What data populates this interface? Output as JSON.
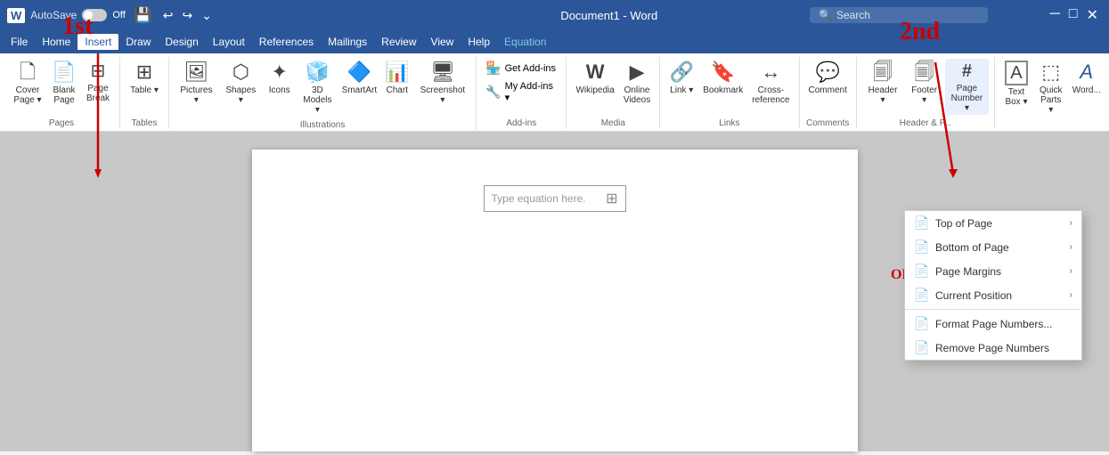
{
  "titlebar": {
    "word_icon": "W",
    "autosave": "AutoSave",
    "toggle_state": "Off",
    "document_title": "Document1 - Word",
    "search_placeholder": "Search"
  },
  "menubar": {
    "items": [
      "File",
      "Home",
      "Insert",
      "Draw",
      "Design",
      "Layout",
      "References",
      "Mailings",
      "Review",
      "View",
      "Help",
      "Equation"
    ],
    "active": "Insert"
  },
  "ribbon": {
    "pages_group": {
      "label": "Pages",
      "buttons": [
        {
          "id": "cover-page",
          "label": "Cover\nPage",
          "icon": "🗋"
        },
        {
          "id": "blank-page",
          "label": "Blank\nPage",
          "icon": "📄"
        },
        {
          "id": "page-break",
          "label": "Page\nBreak",
          "icon": "⊟"
        }
      ]
    },
    "tables_group": {
      "label": "Tables",
      "buttons": [
        {
          "id": "table",
          "label": "Table",
          "icon": "⊞"
        }
      ]
    },
    "illustrations_group": {
      "label": "Illustrations",
      "buttons": [
        {
          "id": "pictures",
          "label": "Pictures",
          "icon": "🖼"
        },
        {
          "id": "shapes",
          "label": "Shapes",
          "icon": "⬡"
        },
        {
          "id": "icons",
          "label": "Icons",
          "icon": "✦"
        },
        {
          "id": "3d-models",
          "label": "3D\nModels",
          "icon": "🧊"
        },
        {
          "id": "smartart",
          "label": "SmartArt",
          "icon": "🔷"
        },
        {
          "id": "chart",
          "label": "Chart",
          "icon": "📊"
        },
        {
          "id": "screenshot",
          "label": "Screenshot",
          "icon": "🖥"
        }
      ]
    },
    "addins_group": {
      "label": "Add-ins",
      "buttons": [
        {
          "id": "get-addins",
          "label": "Get Add-ins",
          "icon": "🏪"
        },
        {
          "id": "my-addins",
          "label": "My Add-ins",
          "icon": "🔧"
        }
      ]
    },
    "media_group": {
      "label": "Media",
      "buttons": [
        {
          "id": "wikipedia",
          "label": "Wikipedia",
          "icon": "W"
        },
        {
          "id": "online-videos",
          "label": "Online\nVideos",
          "icon": "▶"
        }
      ]
    },
    "links_group": {
      "label": "Links",
      "buttons": [
        {
          "id": "link",
          "label": "Link",
          "icon": "🔗"
        },
        {
          "id": "bookmark",
          "label": "Bookmark",
          "icon": "🔖"
        },
        {
          "id": "cross-reference",
          "label": "Cross-\nreference",
          "icon": "↔"
        }
      ]
    },
    "comments_group": {
      "label": "Comments",
      "buttons": [
        {
          "id": "comment",
          "label": "Comment",
          "icon": "💬"
        }
      ]
    },
    "header_footer_group": {
      "label": "Header & F...",
      "buttons": [
        {
          "id": "header",
          "label": "Header",
          "icon": "🗐"
        },
        {
          "id": "footer",
          "label": "Footer",
          "icon": "🗐"
        },
        {
          "id": "page-number",
          "label": "Page\nNumber",
          "icon": "#"
        }
      ]
    },
    "text_group": {
      "label": "",
      "buttons": [
        {
          "id": "text-box",
          "label": "Text\nBox",
          "icon": "A"
        },
        {
          "id": "quick-parts",
          "label": "Quick\nParts",
          "icon": "⬚"
        },
        {
          "id": "wordart",
          "label": "Word...",
          "icon": "A"
        }
      ]
    }
  },
  "dropdown": {
    "items": [
      {
        "id": "top-of-page",
        "label": "Top of Page",
        "has_arrow": true,
        "icon": "📄"
      },
      {
        "id": "bottom-of-page",
        "label": "Bottom of Page",
        "has_arrow": true,
        "icon": "📄"
      },
      {
        "id": "page-margins",
        "label": "Page Margins",
        "has_arrow": true,
        "icon": "📄"
      },
      {
        "id": "current-position",
        "label": "Current Position",
        "has_arrow": true,
        "icon": "📄"
      },
      {
        "id": "format-page-numbers",
        "label": "Format Page Numbers...",
        "has_arrow": false,
        "icon": "📄"
      },
      {
        "id": "remove-page-numbers",
        "label": "Remove Page Numbers",
        "has_arrow": false,
        "icon": "📄"
      }
    ]
  },
  "document": {
    "equation_placeholder": "Type equation here."
  },
  "annotations": {
    "first": "1st",
    "second": "2nd",
    "or": "OR"
  }
}
